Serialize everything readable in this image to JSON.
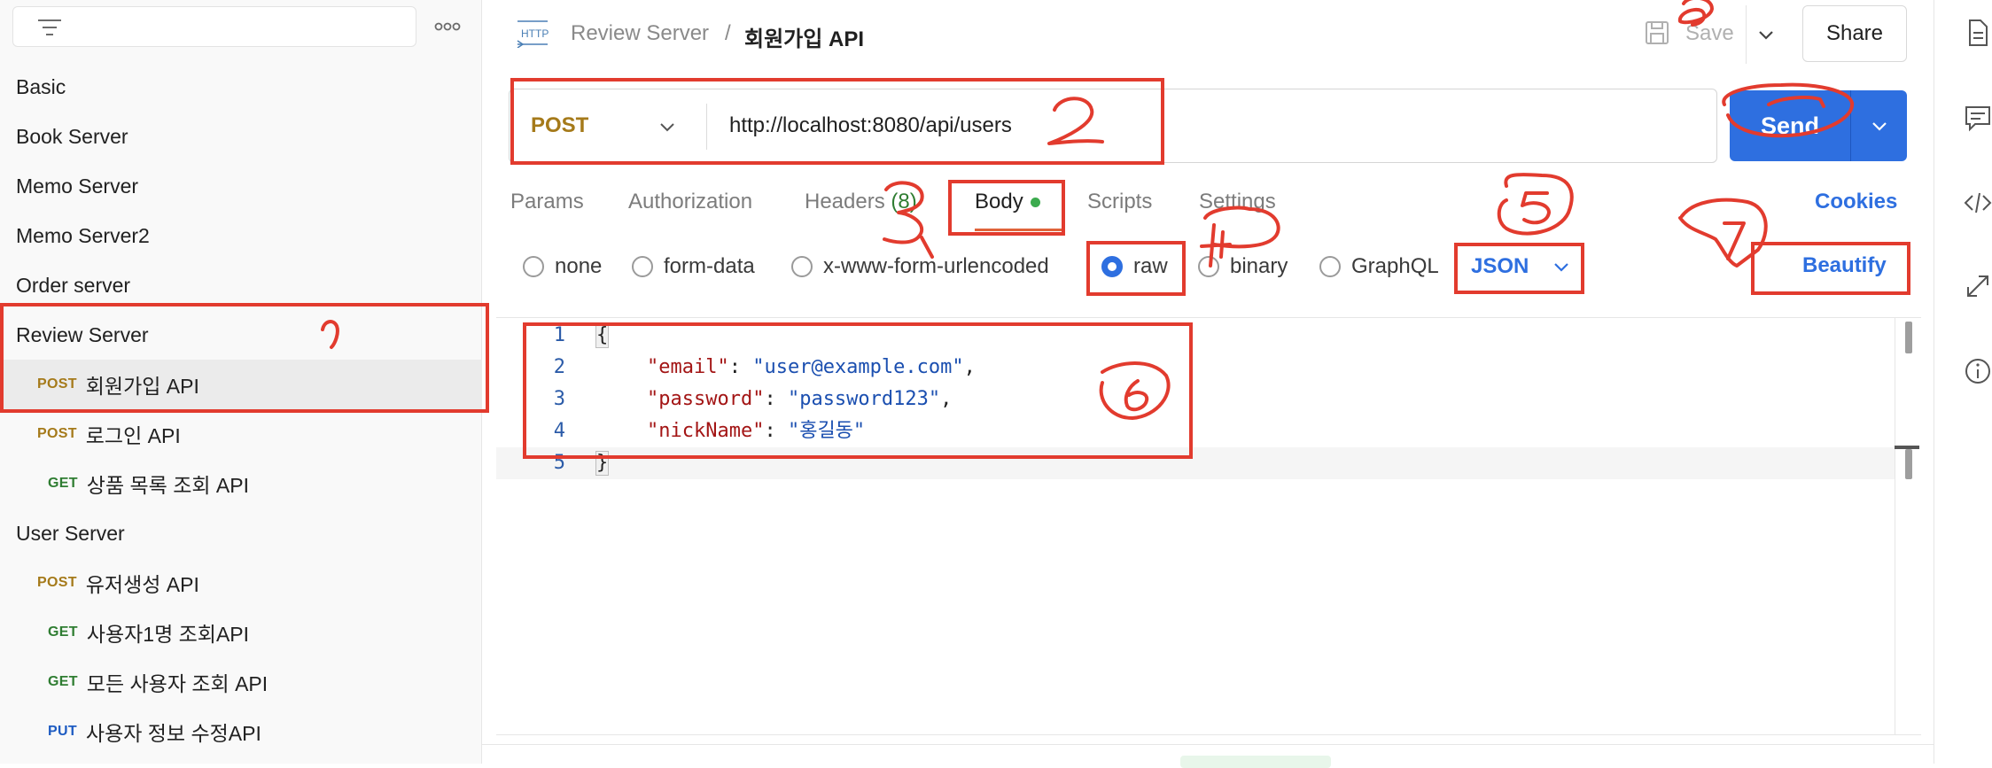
{
  "sidebar": {
    "items": [
      {
        "type": "folder",
        "label": "Basic"
      },
      {
        "type": "folder",
        "label": "Book Server"
      },
      {
        "type": "folder",
        "label": "Memo Server"
      },
      {
        "type": "folder",
        "label": "Memo Server2"
      },
      {
        "type": "folder",
        "label": "Order server"
      },
      {
        "type": "folder",
        "label": "Review Server"
      },
      {
        "type": "request",
        "method": "POST",
        "label": "회원가입 API",
        "selected": true
      },
      {
        "type": "request",
        "method": "POST",
        "label": "로그인 API"
      },
      {
        "type": "request",
        "method": "GET",
        "label": "상품 목록 조회 API"
      },
      {
        "type": "folder",
        "label": "User Server"
      },
      {
        "type": "request",
        "method": "POST",
        "label": "유저생성 API"
      },
      {
        "type": "request",
        "method": "GET",
        "label": "사용자1명 조회API"
      },
      {
        "type": "request",
        "method": "GET",
        "label": "모든 사용자 조회 API"
      },
      {
        "type": "request",
        "method": "PUT",
        "label": "사용자 정보 수정API"
      }
    ]
  },
  "header": {
    "breadcrumb_parent": "Review Server",
    "breadcrumb_sep": "/",
    "breadcrumb_current": "회원가입 API",
    "save_label": "Save",
    "share_label": "Share"
  },
  "request": {
    "method": "POST",
    "url": "http://localhost:8080/api/users",
    "send_label": "Send"
  },
  "tabs": {
    "params": "Params",
    "authorization": "Authorization",
    "headers": "Headers",
    "headers_count": "(8)",
    "body": "Body",
    "scripts": "Scripts",
    "settings": "Settings",
    "cookies": "Cookies"
  },
  "body_types": {
    "none": "none",
    "form_data": "form-data",
    "urlencoded": "x-www-form-urlencoded",
    "raw": "raw",
    "binary": "binary",
    "graphql": "GraphQL",
    "selected": "raw",
    "language": "JSON",
    "beautify": "Beautify"
  },
  "editor": {
    "line_numbers": [
      "1",
      "2",
      "3",
      "4",
      "5"
    ],
    "open_brace": "{",
    "close_brace": "}",
    "fields": [
      {
        "key": "\"email\"",
        "colon": ": ",
        "value": "\"user@example.com\"",
        "comma": ","
      },
      {
        "key": "\"password\"",
        "colon": ": ",
        "value": "\"password123\"",
        "comma": ","
      },
      {
        "key": "\"nickName\"",
        "colon": ": ",
        "value": "\"홍길동\"",
        "comma": ""
      }
    ]
  },
  "annotation_color": "#e23b2e",
  "accent_color": "#2e6fe0"
}
